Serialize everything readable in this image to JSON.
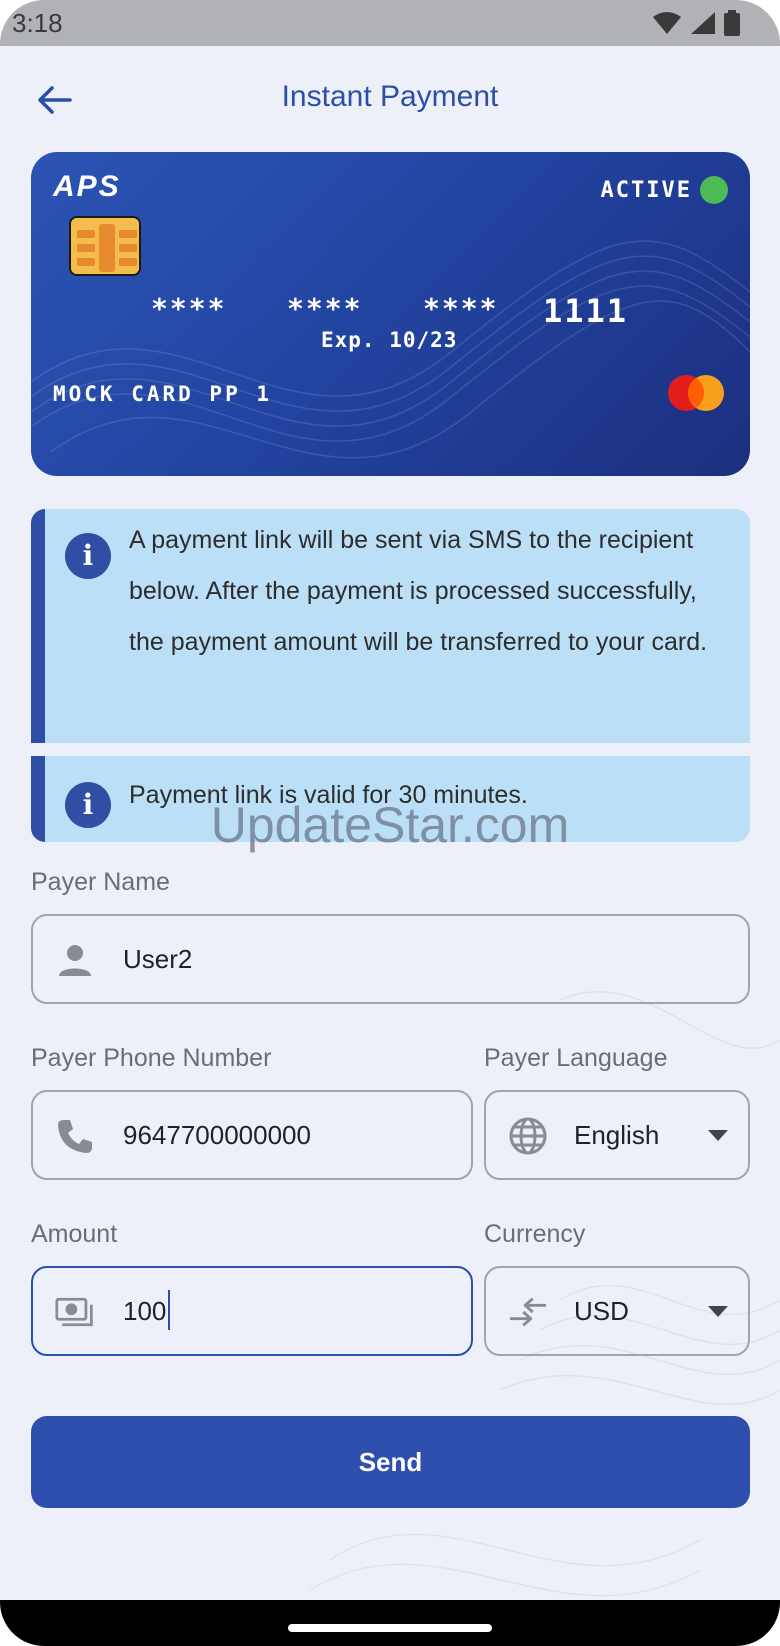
{
  "status_bar": {
    "time": "3:18",
    "icons": [
      "wifi-icon",
      "signal-icon",
      "battery-icon"
    ]
  },
  "app_bar": {
    "title": "Instant Payment",
    "back_icon": "arrow-left-icon"
  },
  "card": {
    "logo": "APS",
    "status": "ACTIVE",
    "status_color": "#4cba55",
    "number_groups": [
      "****",
      "****",
      "****",
      "1111"
    ],
    "expiry": "Exp. 10/23",
    "holder": "MOCK CARD PP 1",
    "brand_icon": "mastercard-icon"
  },
  "info_boxes": [
    {
      "icon": "info-icon",
      "text": "A payment link will be sent via SMS to the recipient below. After the payment is processed successfully, the payment amount will be transferred to your card."
    },
    {
      "icon": "info-icon",
      "text": "Payment link is valid for 30 minutes."
    }
  ],
  "watermark": "UpdateStar.com",
  "form": {
    "payer_name": {
      "label": "Payer Name",
      "value": "User2",
      "icon": "person-icon"
    },
    "payer_phone": {
      "label": "Payer Phone Number",
      "value": "9647700000000",
      "icon": "phone-icon"
    },
    "payer_language": {
      "label": "Payer Language",
      "value": "English",
      "icon": "globe-icon"
    },
    "amount": {
      "label": "Amount",
      "value": "100",
      "icon": "money-icon"
    },
    "currency": {
      "label": "Currency",
      "value": "USD",
      "icon": "exchange-icon"
    }
  },
  "send_button": {
    "label": "Send"
  },
  "colors": {
    "primary": "#2f4fae",
    "info_bg": "#bcdff8",
    "card_start": "#2c54b4",
    "card_end": "#1b2f7e",
    "background": "#eef0f9"
  }
}
